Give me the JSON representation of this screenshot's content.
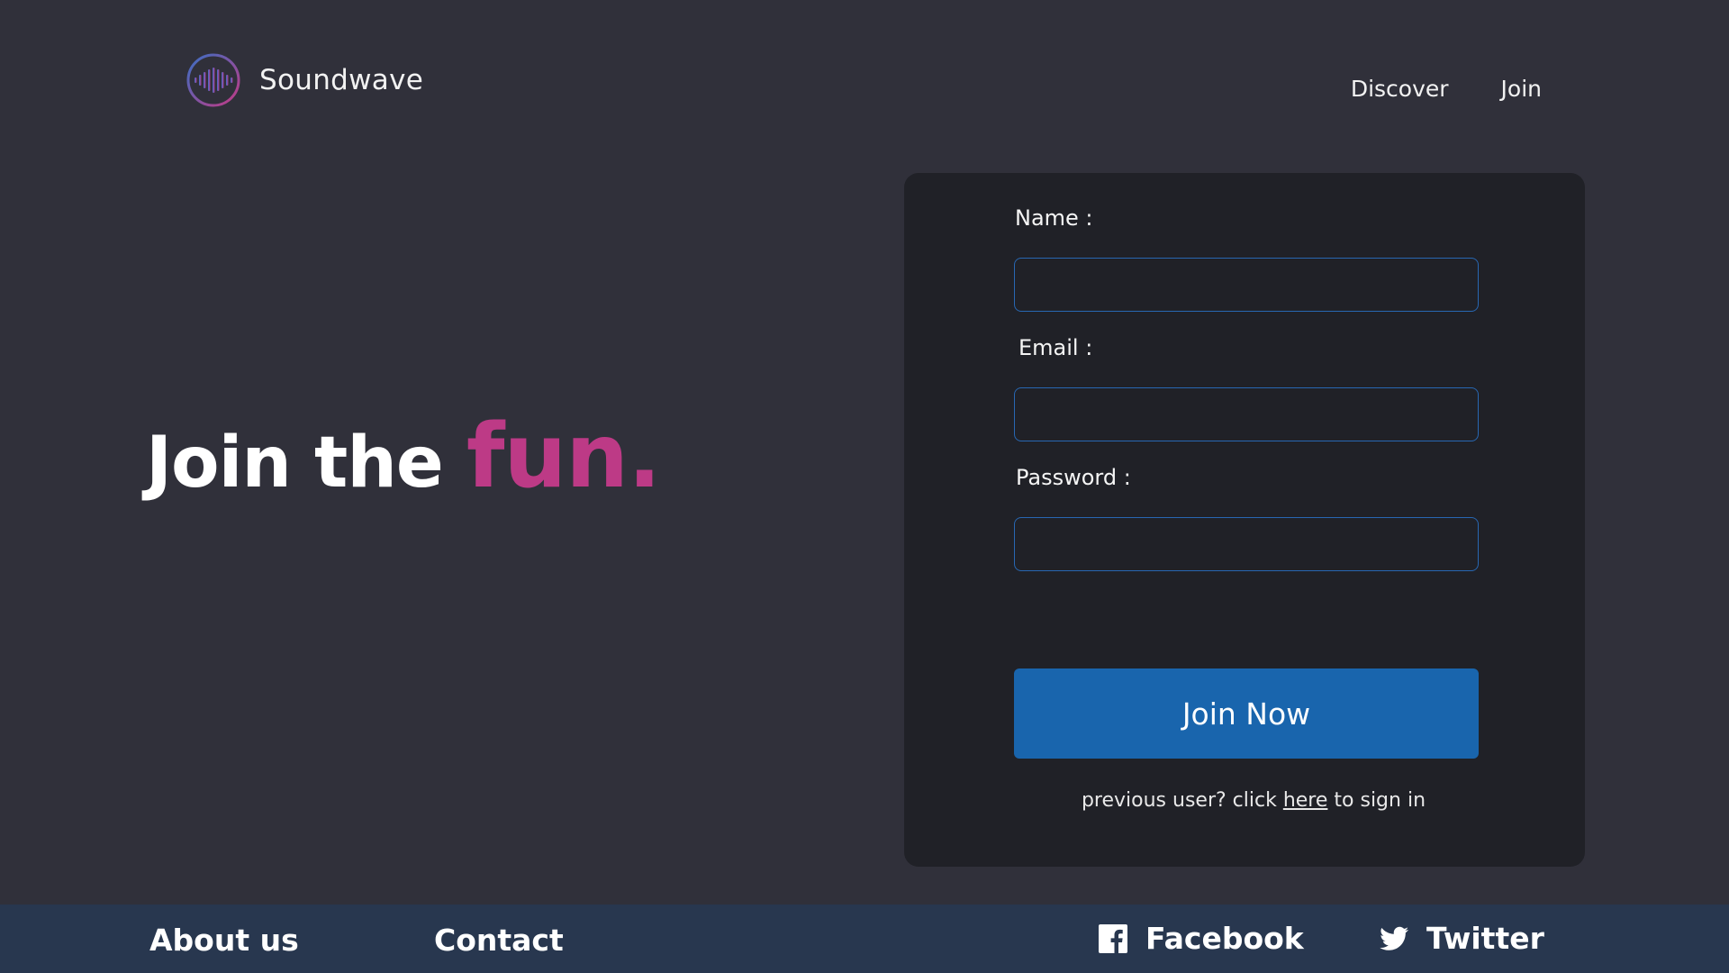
{
  "brand": {
    "name": "Soundwave",
    "icon": "soundwave-logo-icon"
  },
  "nav": {
    "items": [
      {
        "label": "Discover"
      },
      {
        "label": "Join"
      }
    ]
  },
  "hero": {
    "text": "Join the",
    "accent": "fun."
  },
  "form": {
    "name_label": "Name :",
    "name_value": "",
    "email_label": "Email :",
    "email_value": "",
    "password_label": "Password :",
    "password_value": "",
    "submit_label": "Join Now",
    "signin_prefix": "previous user? click",
    "signin_link": "here",
    "signin_suffix": "to sign in"
  },
  "footer": {
    "about": "About us",
    "contact": "Contact",
    "facebook": {
      "label": "Facebook",
      "icon": "facebook-icon"
    },
    "twitter": {
      "label": "Twitter",
      "icon": "twitter-icon"
    }
  },
  "colors": {
    "background": "#30303a",
    "card": "#202127",
    "accent_pink": "#bd3a86",
    "button_blue": "#1965ad",
    "input_border": "#2867b2",
    "footer": "#28374f"
  }
}
